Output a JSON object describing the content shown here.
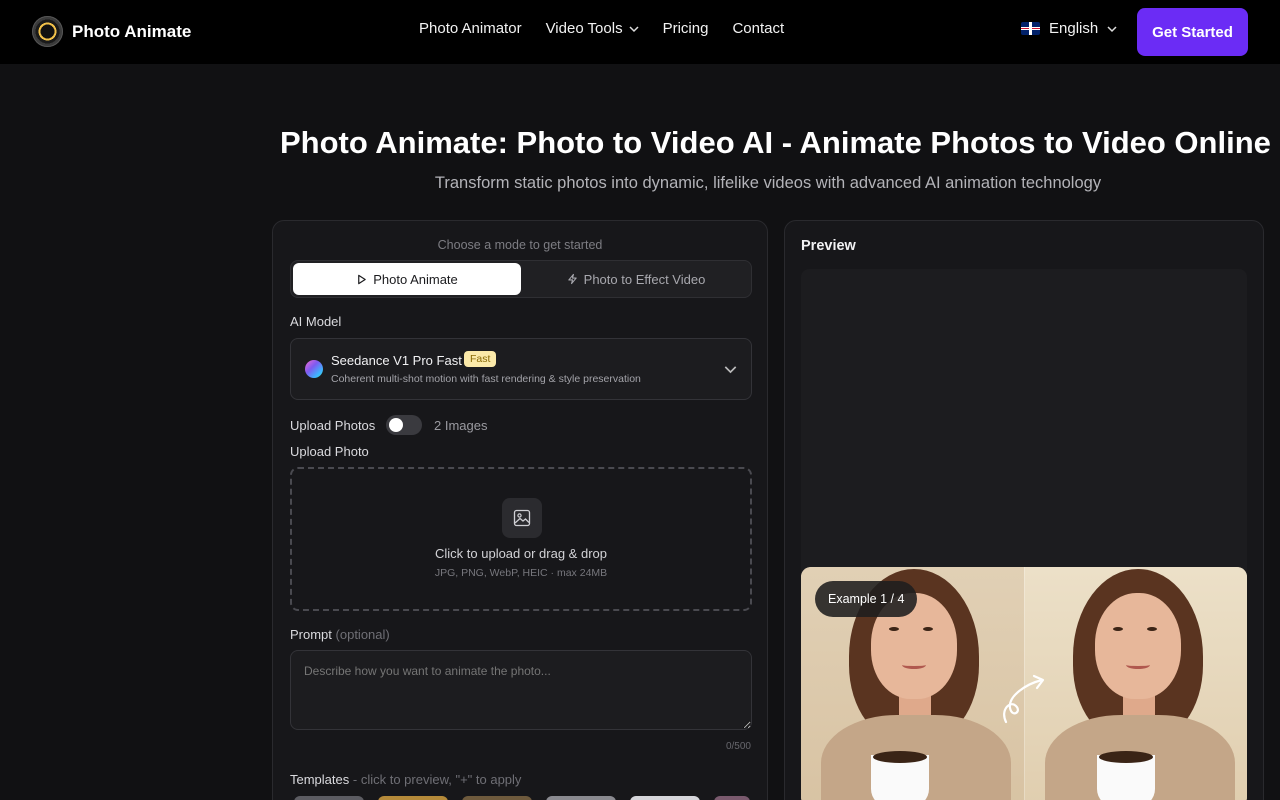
{
  "brand": {
    "name": "Photo Animate"
  },
  "nav": {
    "links": [
      "Photo Animator",
      "Video Tools",
      "Pricing",
      "Contact"
    ],
    "language": "English",
    "cta": "Get Started"
  },
  "hero": {
    "title": "Photo Animate: Photo to Video AI - Animate Photos to Video Online",
    "subtitle": "Transform static photos into dynamic, lifelike videos with advanced AI animation technology"
  },
  "form": {
    "mode_hint": "Choose a mode to get started",
    "tabs": [
      "Photo Animate",
      "Photo to Effect Video"
    ],
    "ai_model_label": "AI Model",
    "model": {
      "name": "Seedance V1 Pro Fast",
      "badge": "Fast",
      "description": "Coherent multi-shot motion with fast rendering & style preservation"
    },
    "upload_photos_label": "Upload Photos",
    "toggle_text": "2 Images",
    "upload_photo_label": "Upload Photo",
    "dropzone": {
      "main": "Click to upload or drag & drop",
      "sub": "JPG, PNG, WebP, HEIC · max 24MB"
    },
    "prompt_label": "Prompt",
    "prompt_optional": "(optional)",
    "prompt_placeholder": "Describe how you want to animate the photo...",
    "char_count": "0/500",
    "templates_label": "Templates",
    "templates_hint": "- click to preview, \"+\" to apply"
  },
  "preview": {
    "title": "Preview",
    "example_badge": "Example 1 / 4"
  },
  "colors": {
    "accent": "#6b2cf5",
    "background": "#111113",
    "panel": "#17171a",
    "badge_bg": "#fbe9a9"
  },
  "icons": [
    "play-icon",
    "bolt-icon",
    "image-icon",
    "chevron-down-icon",
    "uk-flag-icon"
  ]
}
